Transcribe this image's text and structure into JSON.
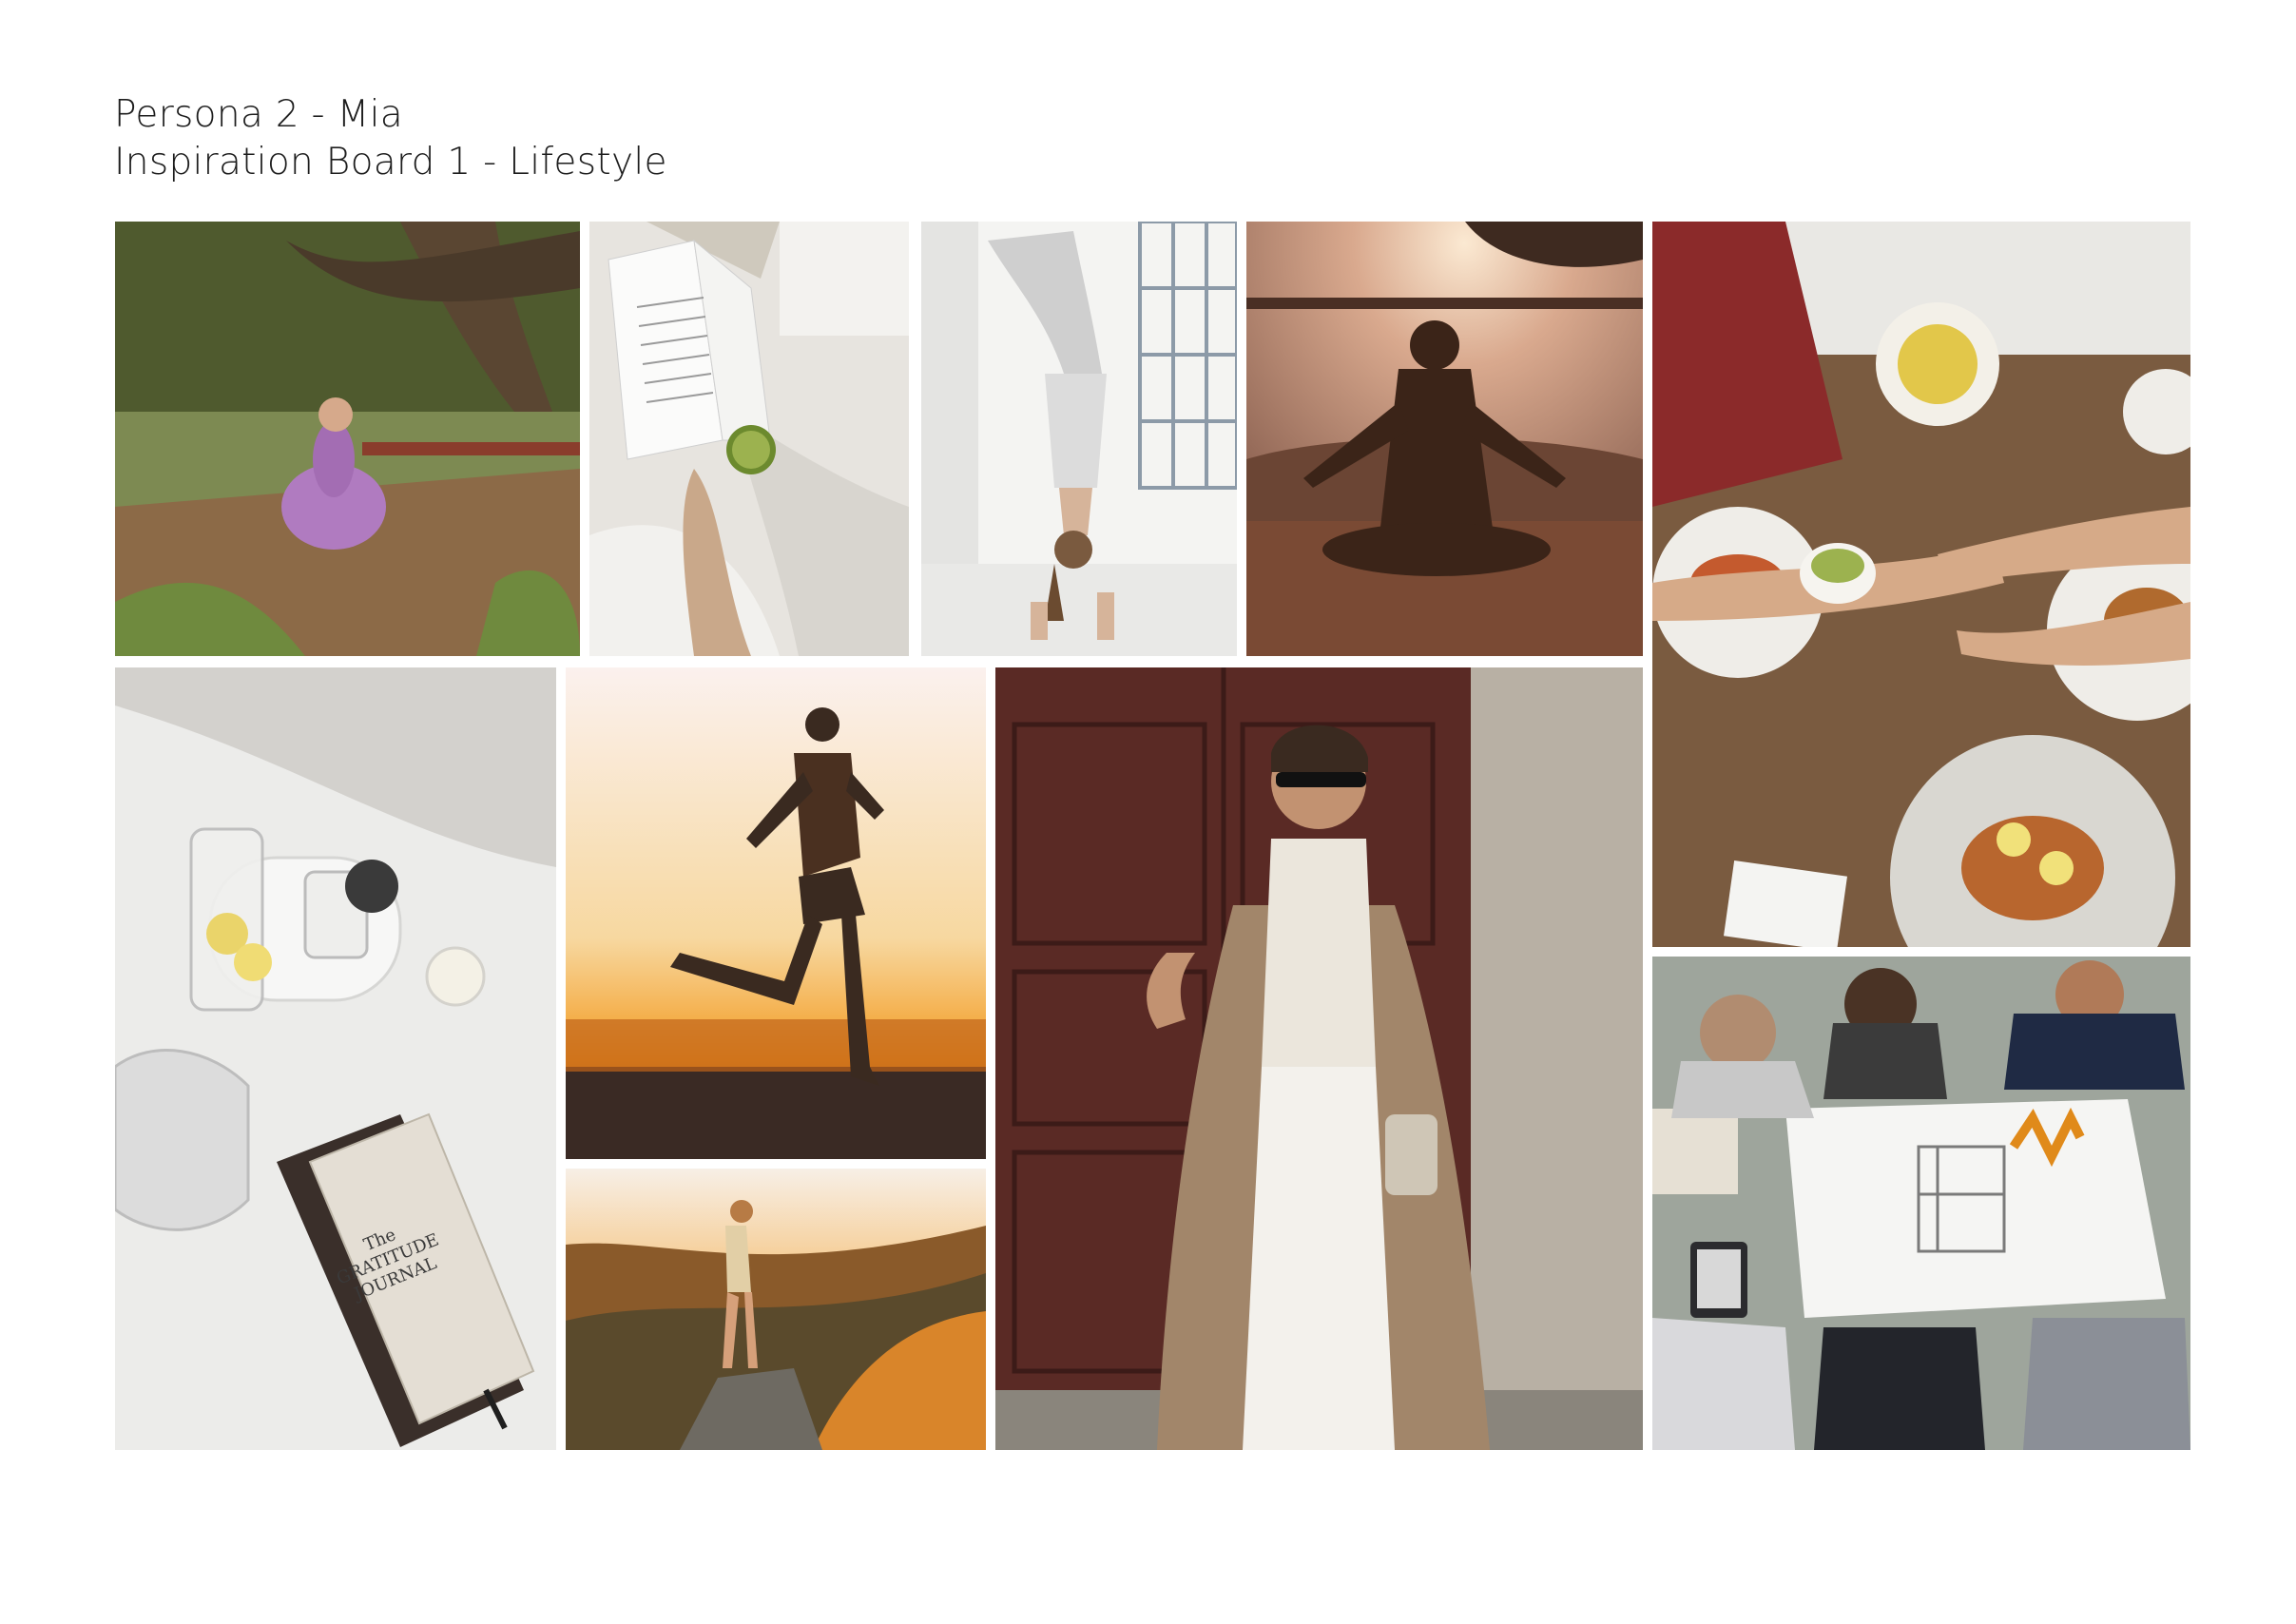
{
  "board": {
    "title": "Persona 2 - Mia",
    "subtitle": "Inspiration Board 1 - Lifestyle"
  },
  "photos": [
    {
      "subject": "meditation-under-tree",
      "palette": [
        "#6f7a45",
        "#8a6a4a",
        "#b07bc0"
      ]
    },
    {
      "subject": "reading-book-with-matcha",
      "palette": [
        "#e9e6e1",
        "#d9d6d0",
        "#6c8a2e"
      ]
    },
    {
      "subject": "handstand-by-window",
      "palette": [
        "#f1f1ef",
        "#cfcfcf",
        "#9aa7b4"
      ]
    },
    {
      "subject": "sunset-meditation-silhouette",
      "palette": [
        "#c79b86",
        "#5a3a2c",
        "#f4d6b8"
      ]
    },
    {
      "subject": "friends-brunch-matcha-toast",
      "palette": [
        "#7a5b40",
        "#e4e2dc",
        "#b6c77a"
      ]
    },
    {
      "subject": "lemon-water-gratitude-journal",
      "palette": [
        "#ececea",
        "#d8d6d2",
        "#e8d46a"
      ]
    },
    {
      "subject": "runner-at-sunrise",
      "palette": [
        "#f6e9e3",
        "#f39a1f",
        "#3a2a20"
      ]
    },
    {
      "subject": "hiker-mountain-sunset",
      "palette": [
        "#f2a23a",
        "#6b4a2a",
        "#3b3a2b"
      ]
    },
    {
      "subject": "street-style-trench-coat",
      "palette": [
        "#5a2a25",
        "#b8aa98",
        "#f0eee8"
      ]
    },
    {
      "subject": "team-meeting-blueprints",
      "palette": [
        "#9ea59c",
        "#f4f4f2",
        "#2c2c34"
      ]
    }
  ],
  "journal_cover_text": "The GRATITUDE JOURNAL"
}
